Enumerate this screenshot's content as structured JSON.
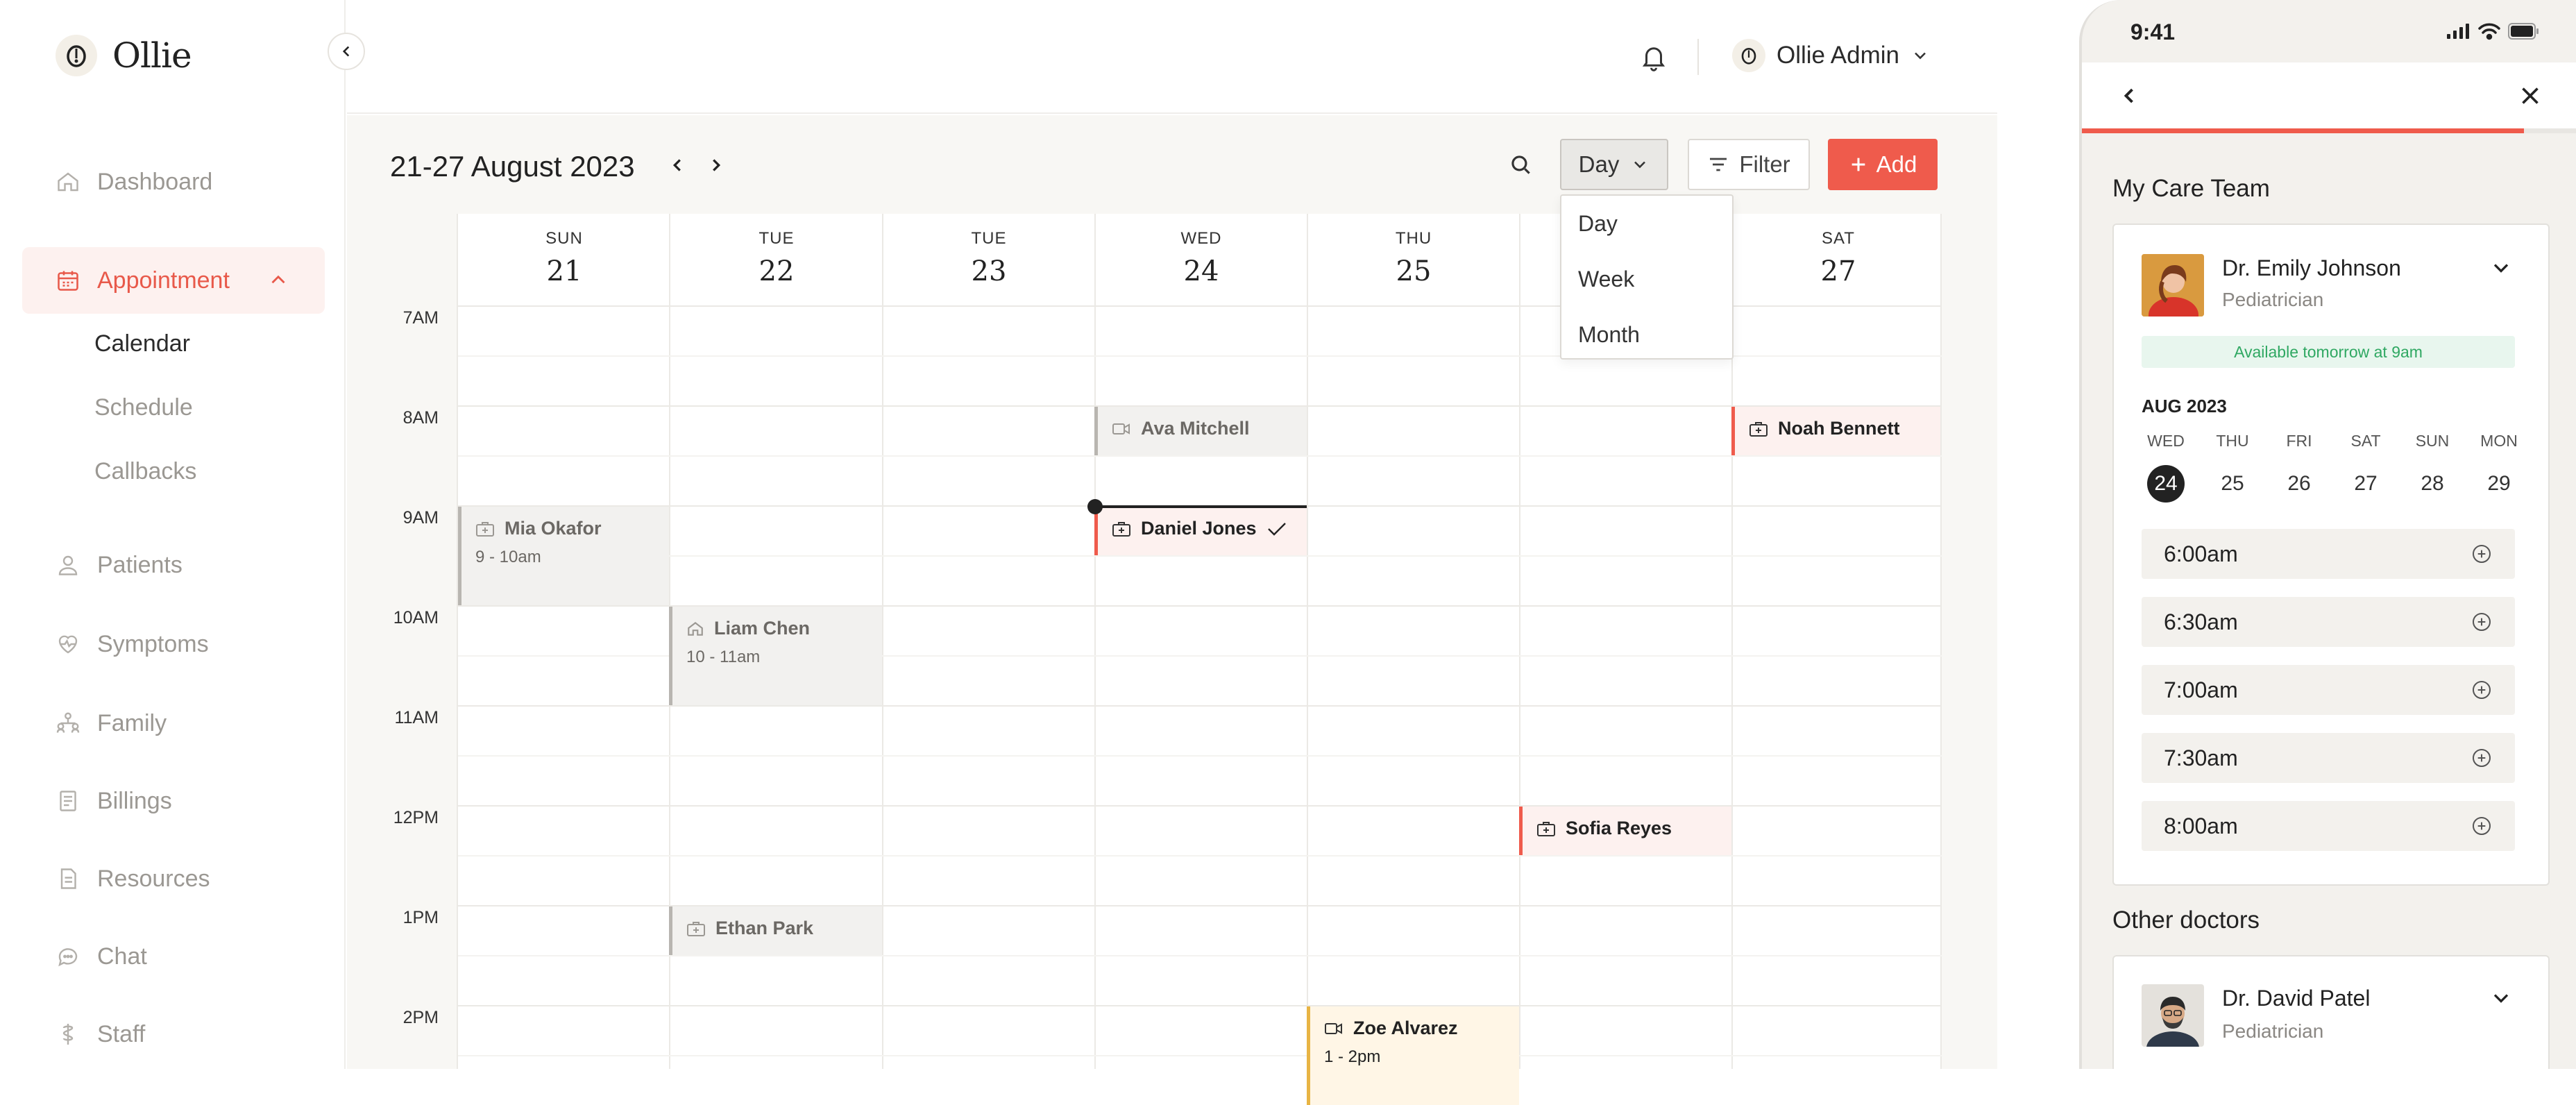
{
  "app": {
    "name": "Ollie"
  },
  "sidebar": {
    "items": [
      {
        "label": "Dashboard",
        "icon": "home-icon"
      },
      {
        "label": "Appointment",
        "icon": "calendar-icon",
        "active": true
      },
      {
        "label": "Patients",
        "icon": "patients-icon"
      },
      {
        "label": "Symptoms",
        "icon": "heart-icon"
      },
      {
        "label": "Family",
        "icon": "family-icon"
      },
      {
        "label": "Billings",
        "icon": "billing-icon"
      },
      {
        "label": "Resources",
        "icon": "document-icon"
      },
      {
        "label": "Chat",
        "icon": "chat-icon"
      },
      {
        "label": "Staff",
        "icon": "staff-icon"
      }
    ],
    "subitems": [
      {
        "label": "Calendar",
        "current": true
      },
      {
        "label": "Schedule"
      },
      {
        "label": "Callbacks"
      }
    ]
  },
  "header": {
    "user_name": "Ollie Admin"
  },
  "toolbar": {
    "date_range": "21-27 August 2023",
    "view_label": "Day",
    "filter_label": "Filter",
    "add_label": "Add",
    "view_options": [
      "Day",
      "Week",
      "Month"
    ]
  },
  "calendar": {
    "days": [
      {
        "dow": "SUN",
        "num": "21"
      },
      {
        "dow": "TUE",
        "num": "22"
      },
      {
        "dow": "TUE",
        "num": "23"
      },
      {
        "dow": "WED",
        "num": "24"
      },
      {
        "dow": "THU",
        "num": "25"
      },
      {
        "dow": "",
        "num": ""
      },
      {
        "dow": "SAT",
        "num": "27"
      }
    ],
    "times": [
      "7AM",
      "8AM",
      "9AM",
      "10AM",
      "11AM",
      "12PM",
      "1PM",
      "2PM"
    ],
    "events": [
      {
        "name": "Ava Mitchell",
        "time": "",
        "style": "grey",
        "icon": "video-icon"
      },
      {
        "name": "Noah Bennett",
        "time": "",
        "style": "red",
        "icon": "medical-bag-icon"
      },
      {
        "name": "Mia Okafor",
        "time": "9 - 10am",
        "style": "grey",
        "icon": "medical-bag-icon"
      },
      {
        "name": "Daniel Jones",
        "time": "",
        "style": "red",
        "icon": "medical-bag-icon",
        "confirmed": true
      },
      {
        "name": "Liam Chen",
        "time": "10 - 11am",
        "style": "grey",
        "icon": "home-icon"
      },
      {
        "name": "Sofia Reyes",
        "time": "",
        "style": "red",
        "icon": "medical-bag-icon"
      },
      {
        "name": "Ethan Park",
        "time": "",
        "style": "grey",
        "icon": "medical-bag-icon"
      },
      {
        "name": "Zoe Alvarez",
        "time": "1 - 2pm",
        "style": "yellow",
        "icon": "video-icon"
      }
    ]
  },
  "phone": {
    "clock": "9:41",
    "progress_fraction": 0.89,
    "care_team_title": "My Care Team",
    "doctor": {
      "name": "Dr. Emily Johnson",
      "role": "Pediatrician",
      "availability": "Available tomorrow at 9am",
      "month": "AUG 2023",
      "week": [
        {
          "dow": "WED",
          "num": "24",
          "selected": true
        },
        {
          "dow": "THU",
          "num": "25"
        },
        {
          "dow": "FRI",
          "num": "26"
        },
        {
          "dow": "SAT",
          "num": "27"
        },
        {
          "dow": "SUN",
          "num": "28"
        },
        {
          "dow": "MON",
          "num": "29"
        }
      ],
      "slots": [
        "6:00am",
        "6:30am",
        "7:00am",
        "7:30am",
        "8:00am"
      ]
    },
    "other_title": "Other doctors",
    "other_doctor": {
      "name": "Dr. David Patel",
      "role": "Pediatrician"
    }
  },
  "colors": {
    "accent": "#ef5b4c",
    "accent_bg": "#fdf1ef",
    "success": "#2fa862",
    "warning": "#e8b444"
  }
}
